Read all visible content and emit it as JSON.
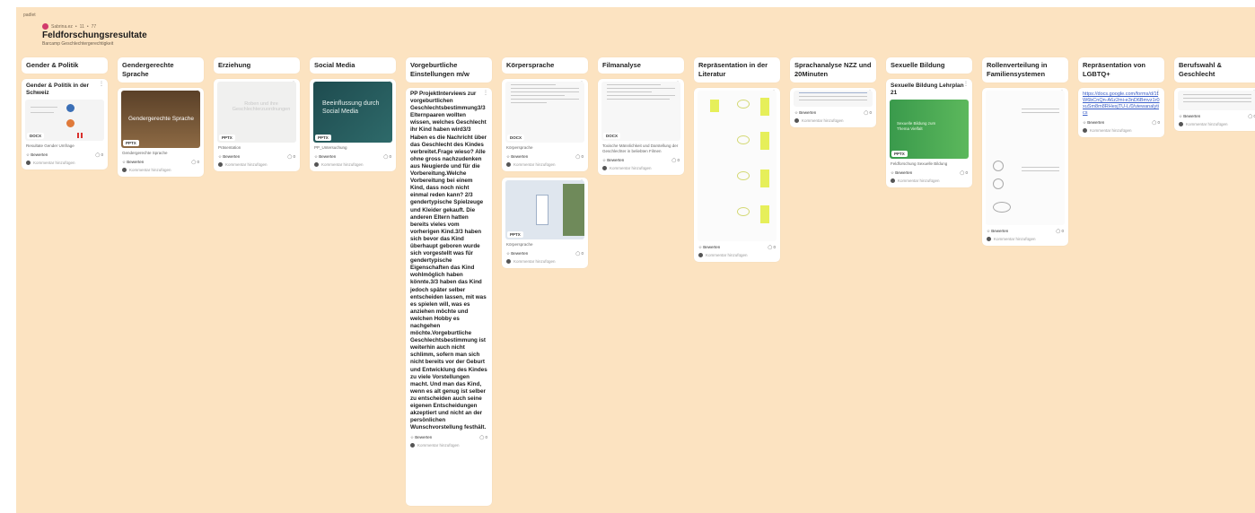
{
  "app": {
    "brand": "padlet",
    "author": "Sabrina.ez",
    "stats_likes": "11",
    "stats_count": "77"
  },
  "board": {
    "title": "Feldforschungsresultate",
    "subtitle": "Barcamp Geschlechtergerechtigkeit",
    "background": "#fce3c1"
  },
  "common": {
    "rate_label": "Bewerten",
    "comment_label": "Kommentar hinzufügen",
    "comment_count": "0"
  },
  "columns": [
    {
      "label": "Gender & Politik"
    },
    {
      "label": "Gendergerechte Sprache"
    },
    {
      "label": "Erziehung"
    },
    {
      "label": "Social Media"
    },
    {
      "label": "Vorgeburtliche Einstellungen m/w"
    },
    {
      "label": "Körpersprache"
    },
    {
      "label": "Filmanalyse"
    },
    {
      "label": "Repräsentation in der Literatur"
    },
    {
      "label": "Sprachanalyse NZZ und 20Minuten"
    },
    {
      "label": "Sexuelle Bildung"
    },
    {
      "label": "Rollenverteilung in Familiensystemen"
    },
    {
      "label": "Repräsentation von LGBTQ+"
    },
    {
      "label": "Berufswahl & Geschlecht"
    }
  ],
  "cards": {
    "gender_politik": {
      "title": "Gender & Politik in der Schweiz",
      "type": "DOCX",
      "caption": "Resultate Gender Umfrage"
    },
    "gendergerechte": {
      "thumb_text": "Gendergerechte Sprache",
      "type": "PPTX",
      "caption": "Gendergerechte Sprache"
    },
    "erziehung": {
      "thumb_text": "Roben und ihre Geschlechterzuordnungen",
      "type": "PPTX",
      "caption": "Präsentation"
    },
    "social_media": {
      "thumb_text": "Beeinflussung durch Social Media",
      "type": "PPTX",
      "caption": "PP_Untersuchung"
    },
    "vorgeburtlich": {
      "text": "PP ProjektInterviews zur vorgeburtlichen Geschlechtsbestimmung3/3 Elternpaaren wollten wissen, welches Geschlecht ihr Kind haben wird3/3 Haben es die Nachricht über das Geschlecht des Kindes verbreitet.Frage wieso? Alle ohne gross nachzudenken aus Neugierde und für die Vorbereitung.Welche Vorbereitung bei einem Kind, dass noch nicht einmal reden kann? 2/3 gendertypische Spielzeuge und Kleider gekauft. Die anderen Eltern hatten bereits vieles vom vorherigen Kind.3/3 haben sich bevor das Kind überhaupt geboren wurde sich vorgestellt was für gendertypische Eigenschaften das Kind wohlmöglich haben könnte.3/3 haben das Kind jedoch später selber entscheiden lassen, mit was es spielen will, was es anziehen möchte und welchen Hobby es nachgehen möchte.Vorgeburtliche Geschlechtsbestimmung ist weiterhin auch nicht schlimm, sofern man sich nicht bereits vor der Geburt und Entwicklung des Kindes zu viele Vorstellungen macht. Und man das Kind, wenn es alt genug ist selber zu entscheiden auch seine eigenen Entscheidungen akzeptiert und nicht an der persönlichen Wunschvorstellung festhält."
    },
    "koerper1": {
      "type": "DOCX",
      "caption": "Körpersprache"
    },
    "koerper2": {
      "type": "PPTX",
      "caption": "Körpersprache"
    },
    "film": {
      "type": "DOCX",
      "caption": "Toxische Männlichkeit und Darstellung der Geschlechter in beliebten Filmen"
    },
    "literatur": {},
    "nzz": {},
    "sexuelle": {
      "title": "Sexuelle Bildung Lehrplan 21",
      "thumb_text": "Sexuelle Bildung zum Thema Vielfalt",
      "type": "PPTX",
      "caption": "Feldforschung Sexuelle Bildung"
    },
    "rollen": {},
    "lgbtq": {
      "link": "https://docs.google.com/forms/d/1fW6bCnQn-A6z2mi-e3nD6Bmvz1r0xuSm8m8RHesjTU-L/0/viewanalytics"
    },
    "beruf": {}
  }
}
